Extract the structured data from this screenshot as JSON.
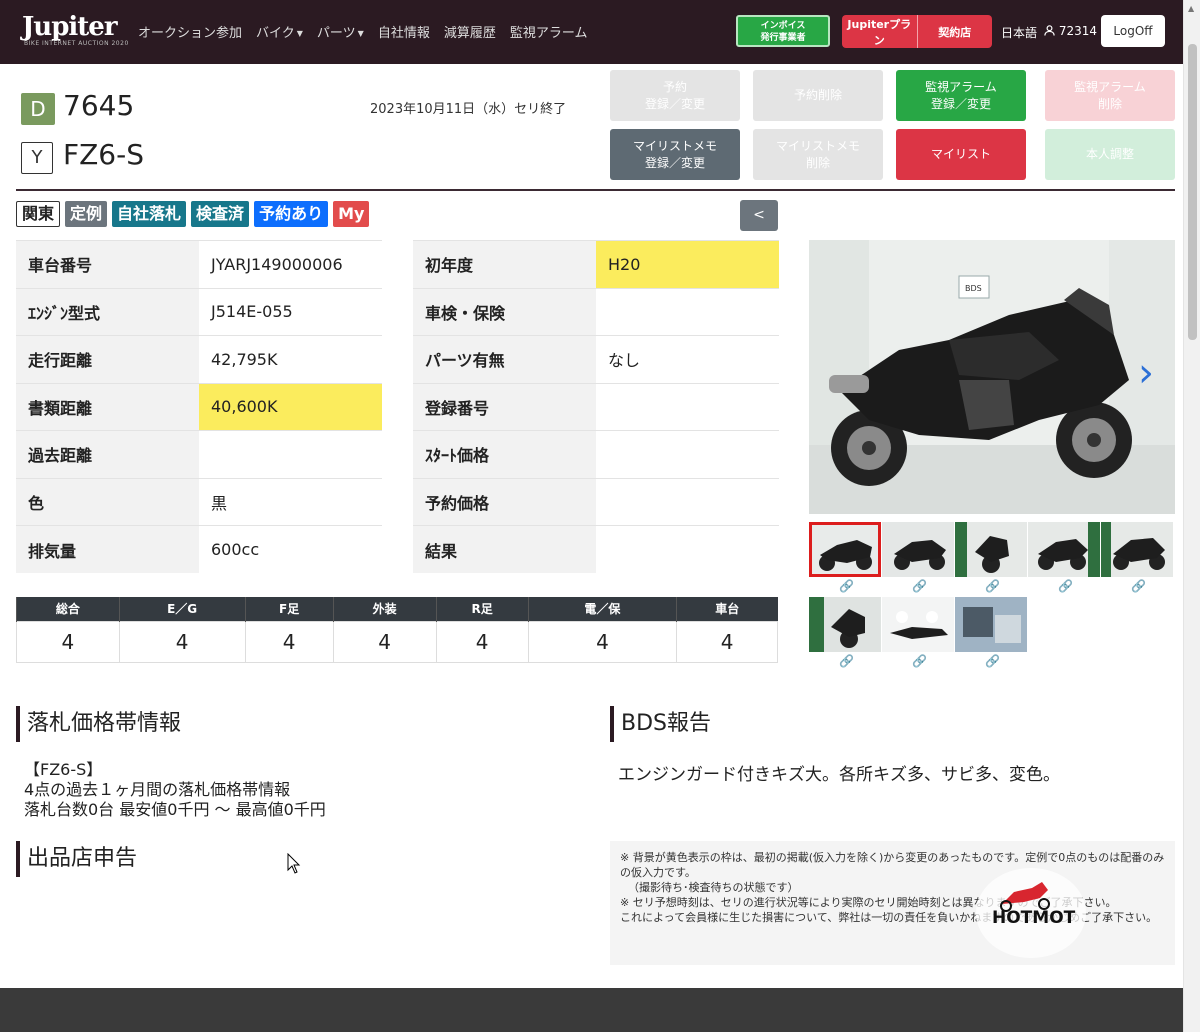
{
  "nav": {
    "logo": "Jupiter",
    "logo_sub": "BIKE INTERNET AUCTION 2020",
    "links": [
      "オークション参加",
      "バイク",
      "パーツ",
      "自社情報",
      "減算履歴",
      "監視アラーム"
    ],
    "invoice_line1": "インボイス",
    "invoice_line2": "発行事業者",
    "plan_label": "Jupiterプラン",
    "contract_label": "契約店",
    "language": "日本語",
    "user_id": "72314",
    "logoff": "LogOff"
  },
  "header": {
    "region_badge": "D",
    "lot_number": "7645",
    "type_badge": "Y",
    "model_name": "FZ6-S",
    "auction_end": "2023年10月11日（水）セリ終了"
  },
  "actions": {
    "reserve": "予約\n登録／変更",
    "reserve_delete": "予約削除",
    "alarm": "監視アラーム\n登録／変更",
    "alarm_delete": "監視アラーム\n削除",
    "memo": "マイリストメモ\n登録／変更",
    "memo_delete": "マイリストメモ\n削除",
    "mylist": "マイリスト",
    "self_adjust": "本人調整"
  },
  "tags": [
    "関東",
    "定例",
    "自社落札",
    "検査済",
    "予約あり",
    "My"
  ],
  "back_button": "<",
  "specs_left": [
    {
      "label": "車台番号",
      "value": "JYARJ149000006",
      "highlight": false
    },
    {
      "label": "ｴﾝｼﾞﾝ型式",
      "value": "J514E-055",
      "highlight": false
    },
    {
      "label": "走行距離",
      "value": "42,795K",
      "highlight": false
    },
    {
      "label": "書類距離",
      "value": "40,600K",
      "highlight": true
    },
    {
      "label": "過去距離",
      "value": "",
      "highlight": false
    },
    {
      "label": "色",
      "value": "黒",
      "highlight": false
    },
    {
      "label": "排気量",
      "value": "600cc",
      "highlight": false
    }
  ],
  "specs_right": [
    {
      "label": "初年度",
      "value": "H20",
      "highlight": true
    },
    {
      "label": "車検・保険",
      "value": "",
      "highlight": false
    },
    {
      "label": "パーツ有無",
      "value": "なし",
      "highlight": false
    },
    {
      "label": "登録番号",
      "value": "",
      "highlight": false
    },
    {
      "label": "ｽﾀｰﾄ価格",
      "value": "",
      "highlight": false
    },
    {
      "label": "予約価格",
      "value": "",
      "highlight": false
    },
    {
      "label": "結果",
      "value": "",
      "highlight": false
    }
  ],
  "scores": {
    "headers": [
      "総合",
      "E／G",
      "F足",
      "外装",
      "R足",
      "電／保",
      "車台"
    ],
    "values": [
      "4",
      "4",
      "4",
      "4",
      "4",
      "4",
      "4"
    ]
  },
  "gallery": {
    "selected_index": 0,
    "thumbnail_count": 8,
    "main_alt": "black sport motorcycle in BDS photo booth"
  },
  "price_section": {
    "title": "落札価格帯情報",
    "line1": "【FZ6-S】",
    "line2": "4点の過去１ヶ月間の落札価格帯情報",
    "line3": "落札台数0台 最安値0千円 〜 最高値0千円"
  },
  "seller_section": {
    "title": "出品店申告"
  },
  "bds_section": {
    "title": "BDS報告",
    "report": "エンジンガード付きキズ大。各所キズ多、サビ多、変色。"
  },
  "notice": {
    "line1": "※ 背景が黄色表示の枠は、最初の掲載(仮入力を除く)から変更のあったものです。定例で0点のものは配番のみの仮入力です。",
    "line2": "（撮影待ち･検査待ちの状態です）",
    "line3": "※ セリ予想時刻は、セリの進行状況等により実際のセリ開始時刻とは異なりますのでご了承下さい。",
    "line4": "これによって会員様に生じた損害について、弊社は一切の責任を負いかねますのであらかじめご了承下さい。"
  },
  "watermark": "HOTMOT",
  "colors": {
    "nav": "#2b1a22",
    "highlight": "#fbec5d",
    "green": "#28a745",
    "red": "#dc3545"
  }
}
